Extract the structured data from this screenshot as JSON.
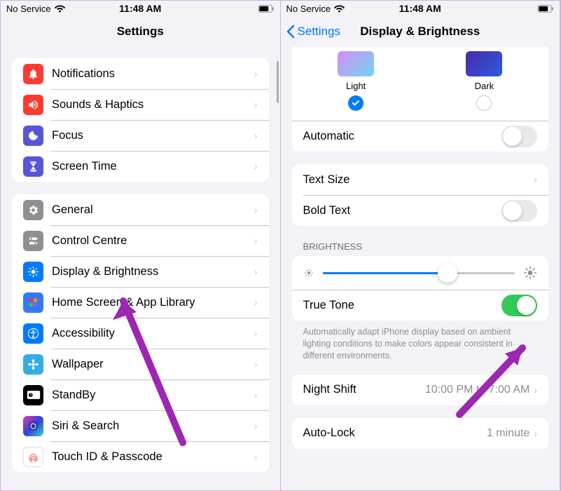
{
  "status": {
    "carrier": "No Service",
    "time": "11:48 AM"
  },
  "left": {
    "title": "Settings",
    "group1": [
      {
        "icon": "bell",
        "bg": "bg-red",
        "label": "Notifications"
      },
      {
        "icon": "speaker",
        "bg": "bg-red2",
        "label": "Sounds & Haptics"
      },
      {
        "icon": "moon",
        "bg": "bg-indigo",
        "label": "Focus"
      },
      {
        "icon": "hourglass",
        "bg": "bg-screentime",
        "label": "Screen Time"
      }
    ],
    "group2": [
      {
        "icon": "gear",
        "bg": "bg-gray",
        "label": "General"
      },
      {
        "icon": "switches",
        "bg": "bg-gray2",
        "label": "Control Centre"
      },
      {
        "icon": "sun",
        "bg": "bg-blue",
        "label": "Display & Brightness"
      },
      {
        "icon": "grid",
        "bg": "bg-home",
        "label": "Home Screen & App Library"
      },
      {
        "icon": "person",
        "bg": "bg-access",
        "label": "Accessibility"
      },
      {
        "icon": "flower",
        "bg": "bg-cyan",
        "label": "Wallpaper"
      },
      {
        "icon": "standby",
        "bg": "bg-black",
        "label": "StandBy"
      },
      {
        "icon": "siri",
        "bg": "bg-siri",
        "label": "Siri & Search"
      },
      {
        "icon": "touchid",
        "bg": "bg-touchid",
        "label": "Touch ID & Passcode"
      }
    ]
  },
  "right": {
    "back": "Settings",
    "title": "Display & Brightness",
    "appearance": {
      "light": "Light",
      "dark": "Dark"
    },
    "automatic": "Automatic",
    "text_size": "Text Size",
    "bold_text": "Bold Text",
    "brightness_header": "BRIGHTNESS",
    "true_tone": "True Tone",
    "true_tone_footer": "Automatically adapt iPhone display based on ambient lighting conditions to make colors appear consistent in different environments.",
    "night_shift": "Night Shift",
    "night_shift_detail": "10:00 PM to 7:00 AM",
    "auto_lock": "Auto-Lock",
    "auto_lock_detail": "1 minute",
    "slider_pct": 65
  }
}
